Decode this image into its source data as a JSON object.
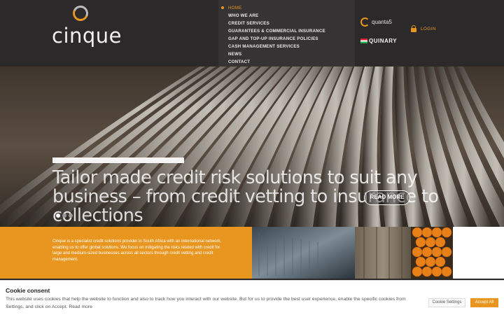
{
  "brand": {
    "name": "cinque"
  },
  "nav": {
    "items": [
      {
        "label": "HOME",
        "active": true
      },
      {
        "label": "WHO WE ARE"
      },
      {
        "label": "CREDIT SERVICES"
      },
      {
        "label": "GUARANTEES & COMMERCIAL INSURANCE"
      },
      {
        "label": "GAP AND TOP-UP INSURANCE POLICIES"
      },
      {
        "label": "CASH MANAGEMENT SERVICES"
      },
      {
        "label": "NEWS"
      },
      {
        "label": "CONTACT"
      }
    ]
  },
  "partners": {
    "first": "quanta5",
    "second": "QUINARY"
  },
  "login": {
    "label": "LOGIN"
  },
  "hero": {
    "title": "Tailor made credit risk solutions to suit any business – from credit vetting to insurance to collections",
    "cta": "READ MORE",
    "slides": 3,
    "active_slide": 0
  },
  "intro": {
    "text": "Cinque is a specialist credit solutions provider in South Africa with an international network, enabling us to offer global solutions. We focus on mitigating the risks related with credit for large and medium-sized businesses across all sectors through credit vetting and credit management."
  },
  "cookie": {
    "title": "Cookie consent",
    "text": "This website uses cookies that help the website to function and also to track how you interact with our website. But for us to provide the best user experience, enable the specific cookies from Settings, and click on Accept.",
    "read_more": "Read more",
    "settings_label": "Cookie Settings",
    "accept_label": "Accept All"
  },
  "colors": {
    "accent": "#e8961f",
    "header_bg": "#2c292a",
    "nav_bg": "#363334"
  }
}
